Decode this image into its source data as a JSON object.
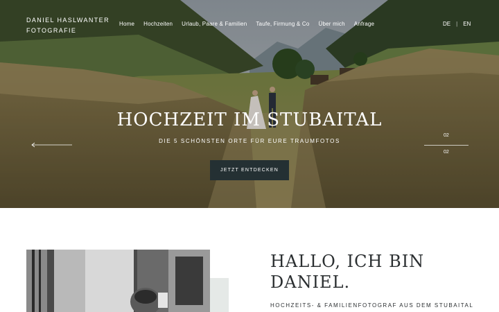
{
  "brand": {
    "line1": "DANIEL HASLWANTER",
    "line2": "FOTOGRAFIE"
  },
  "nav": {
    "items": [
      {
        "label": "Home"
      },
      {
        "label": "Hochzeiten"
      },
      {
        "label": "Urlaub, Paare & Familien"
      },
      {
        "label": "Taufe, Firmung & Co"
      },
      {
        "label": "Über mich"
      },
      {
        "label": "Anfrage"
      }
    ]
  },
  "lang": {
    "de": "DE",
    "sep": "|",
    "en": "EN"
  },
  "hero": {
    "title": "HOCHZEIT IM STUBAITAL",
    "subtitle": "DIE 5 SCHÖNSTEN ORTE FÜR EURE TRAUMFOTOS",
    "cta": "JETZT ENTDECKEN",
    "slide_current": "02",
    "slide_total": "02"
  },
  "about": {
    "title_line1": "HALLO, ICH BIN",
    "title_line2": "DANIEL.",
    "subtitle": "HOCHZEITS- & FAMILIENFOTOGRAF AUS DEM STUBAITAL"
  },
  "colors": {
    "accent_dark": "#243033",
    "text_dark": "#2b2f31",
    "accent_light": "#e5e9e7"
  },
  "icons": {
    "prev": "arrow-left-icon"
  }
}
